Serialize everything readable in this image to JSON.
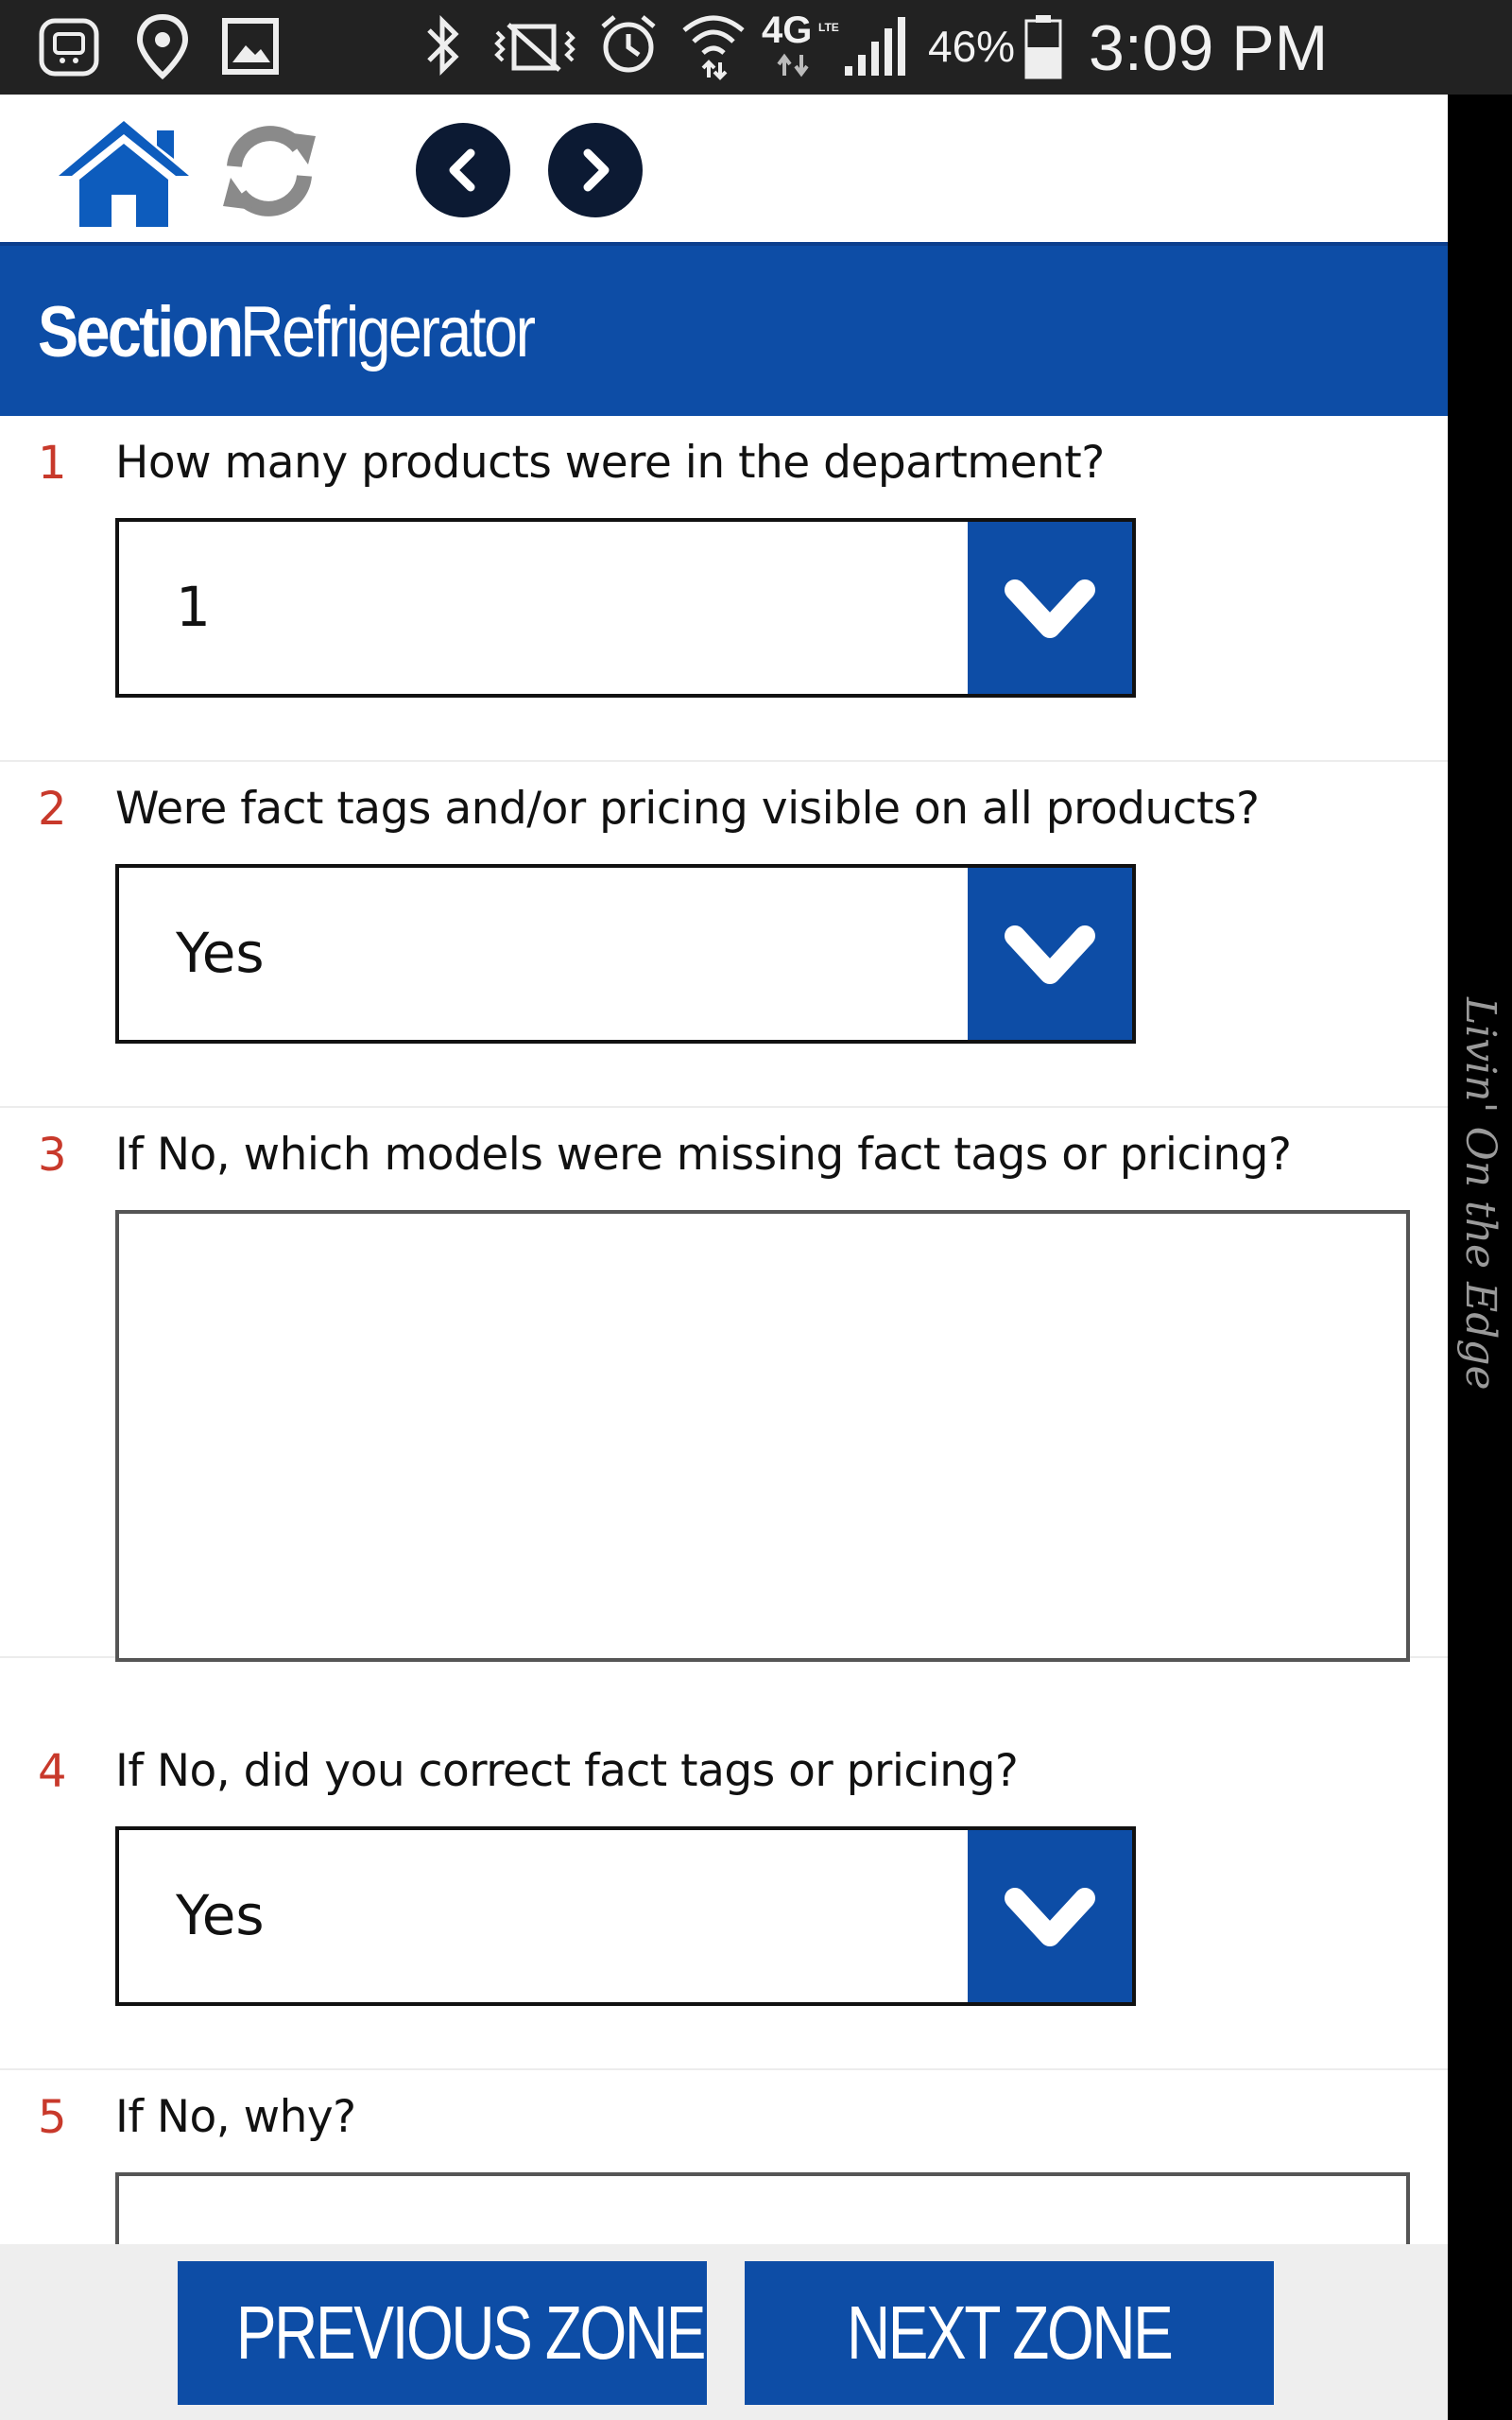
{
  "status_bar": {
    "network": "4G",
    "network_sub": "LTE",
    "battery_percent": "46%",
    "time": "3:09 PM"
  },
  "toolbar": {
    "icons": [
      "home-icon",
      "refresh-icon",
      "chevron-left-icon",
      "chevron-right-icon"
    ]
  },
  "section": {
    "label": "Section",
    "name": "Refrigerator"
  },
  "questions": [
    {
      "number": "1",
      "text": "How many products were in the department?",
      "type": "select",
      "value": "1"
    },
    {
      "number": "2",
      "text": "Were fact tags and/or pricing visible on all products?",
      "type": "select",
      "value": "Yes"
    },
    {
      "number": "3",
      "text": "If No, which models were missing fact tags or pricing?",
      "type": "textarea",
      "value": ""
    },
    {
      "number": "4",
      "text": "If No, did you correct fact tags or pricing?",
      "type": "select",
      "value": "Yes"
    },
    {
      "number": "5",
      "text": "If No, why?",
      "type": "textarea",
      "value": ""
    }
  ],
  "footer": {
    "previous_label": "PREVIOUS ZONE",
    "next_label": "NEXT ZONE"
  },
  "watermark": "Livin' On the Edge",
  "colors": {
    "accent": "#0d4da6",
    "question_number": "#c8392b",
    "status_bar": "#222222"
  }
}
